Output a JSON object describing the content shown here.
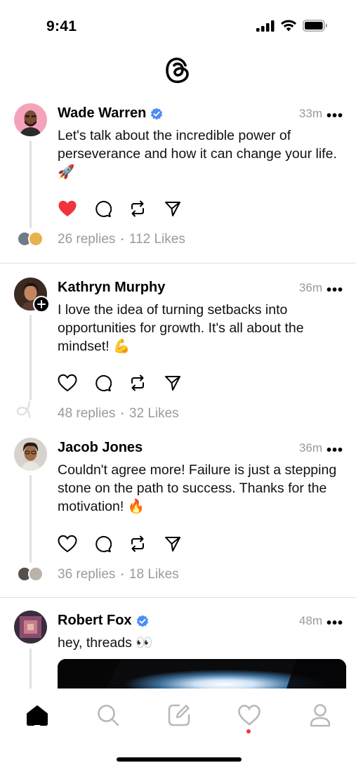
{
  "status_bar": {
    "time": "9:41"
  },
  "colors": {
    "accent_like": "#f0333c",
    "verified": "#4a8df6",
    "muted_text": "#9a9a9a"
  },
  "posts": [
    {
      "author": "Wade Warren",
      "verified": true,
      "time": "33m",
      "text": "Let's talk about the incredible power of perseverance and how it can change your life. 🚀",
      "liked": true,
      "replies": "26 replies",
      "likes": "112 Likes"
    },
    {
      "author": "Kathryn Murphy",
      "verified": false,
      "time": "36m",
      "text": "I love the idea of turning setbacks into opportunities for growth. It's all about the mindset! 💪",
      "liked": false,
      "replies": "48 replies",
      "likes": "32 Likes"
    },
    {
      "author": "Jacob Jones",
      "verified": false,
      "time": "36m",
      "text": "Couldn't agree more! Failure is just a stepping stone on the path to success. Thanks for the motivation! 🔥",
      "liked": false,
      "replies": "36 replies",
      "likes": "18 Likes"
    },
    {
      "author": "Robert Fox",
      "verified": true,
      "time": "48m",
      "text": "hey, threads 👀"
    }
  ],
  "icons": {
    "more": "more-horizontal-icon",
    "like": "heart-icon",
    "comment": "comment-icon",
    "repost": "repost-icon",
    "share": "send-icon"
  },
  "more_label": "•••",
  "stats_separator": "•",
  "tab_bar": {
    "items": [
      "home-icon",
      "search-icon",
      "compose-icon",
      "activity-icon",
      "profile-icon"
    ],
    "active": "home-icon",
    "activity_has_notification": true
  }
}
